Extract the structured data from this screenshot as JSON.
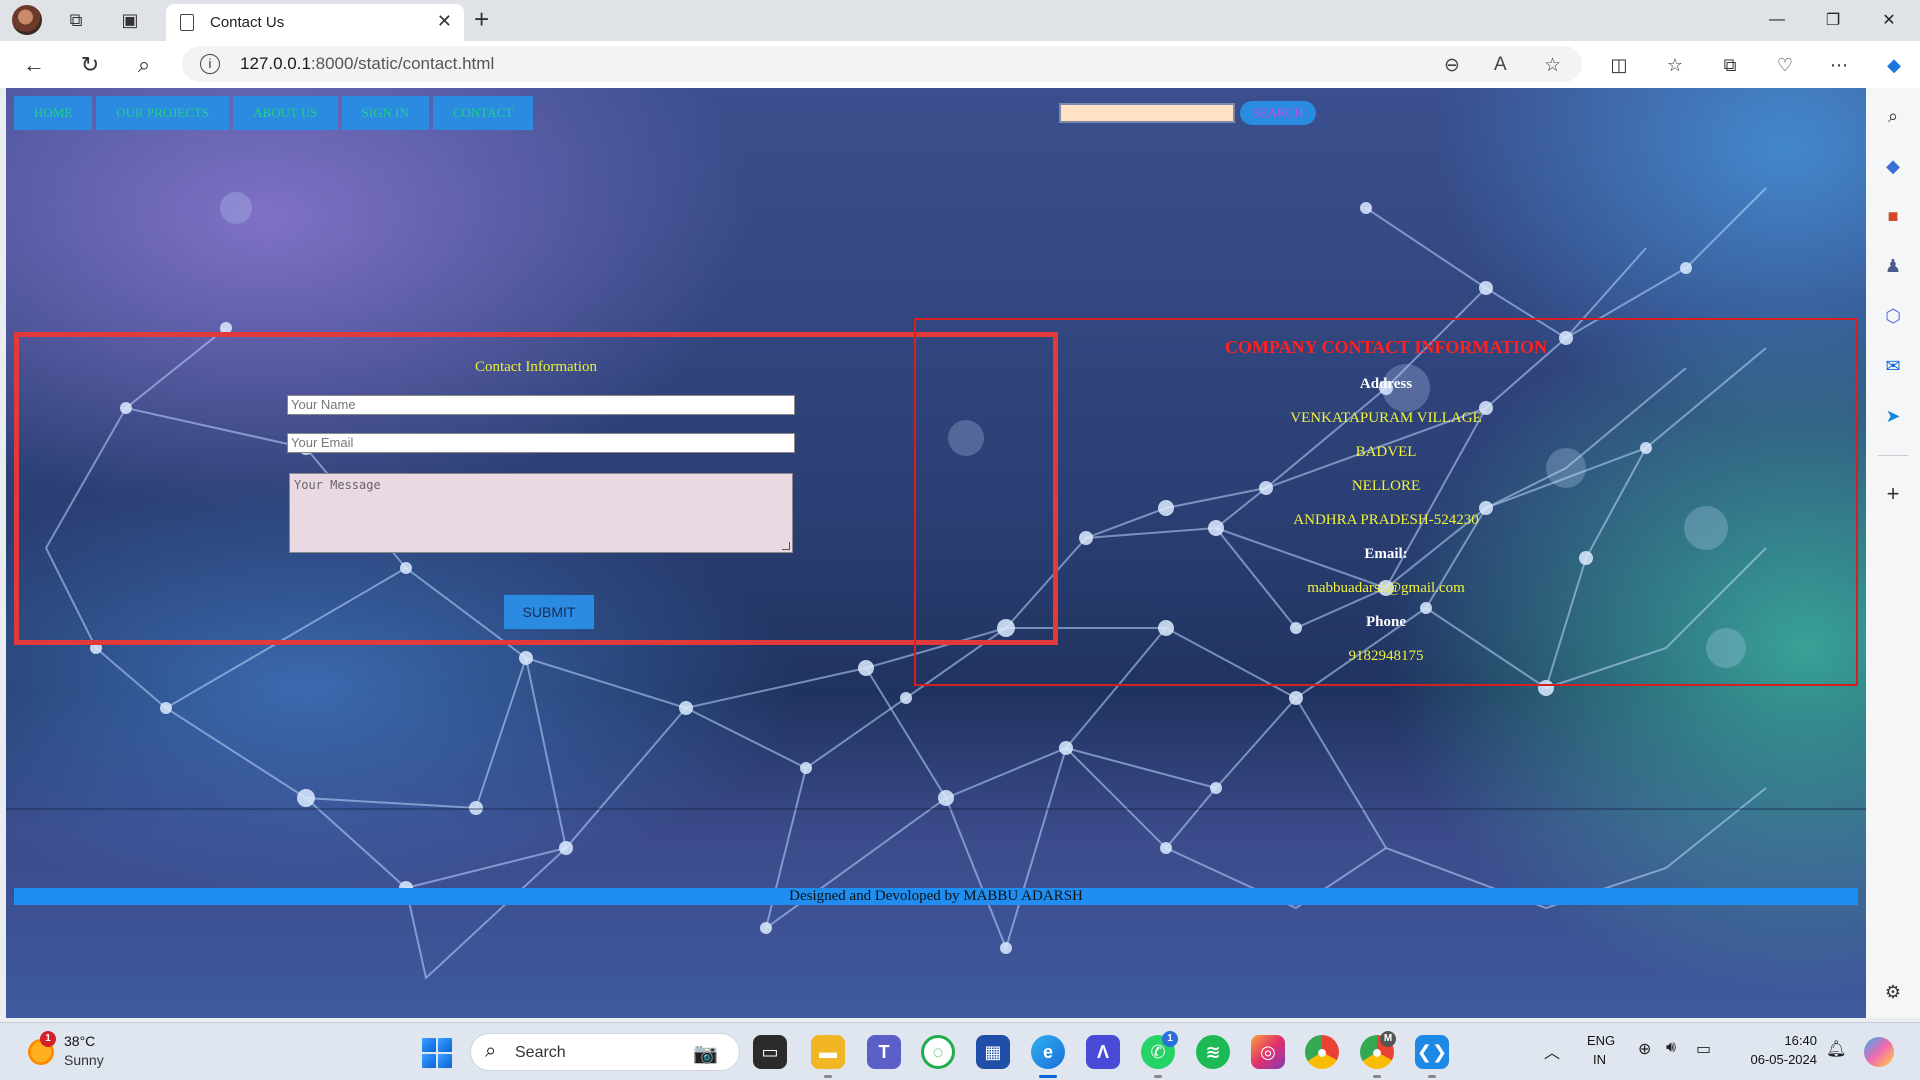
{
  "browser": {
    "tab_title": "Contact Us",
    "url_host": "127.0.0.1",
    "url_rest": ":8000/static/contact.html"
  },
  "site": {
    "nav": [
      "HOME",
      "OUR PROJECTS",
      "ABOUT US",
      "SIGN IN",
      "CONTACT"
    ],
    "search_button": "SEARCH",
    "form": {
      "title": "Contact Information",
      "name_placeholder": "Your Name",
      "email_placeholder": "Your Email",
      "message_placeholder": "Your Message",
      "submit": "SUBMIT"
    },
    "company": {
      "title": "COMPANY CONTACT INFORMATION",
      "address_label": "Address",
      "address_lines": [
        "VENKATAPURAM VILLAGE",
        "BADVEL",
        "NELLORE",
        "ANDHRA PRADESH-524230"
      ],
      "email_label": "Email:",
      "email": "mabbuadarsh@gmail.com",
      "phone_label": "Phone",
      "phone": "9182948175"
    },
    "footer": "Designed and Devoloped by MABBU ADARSH"
  },
  "taskbar": {
    "weather_badge": "1",
    "temperature": "38°C",
    "weather": "Sunny",
    "search_label": "Search",
    "whatsapp_badge": "1",
    "chrome_badge": "M",
    "lang_top": "ENG",
    "lang_bottom": "IN",
    "time": "16:40",
    "date": "06-05-2024"
  },
  "colors": {
    "nav_bg": "#2a8be0",
    "nav_text": "#23d08a",
    "panel_border": "#e23a3a",
    "info_title": "#ff2020",
    "info_value": "#f2f23a",
    "footer_bg": "#1f8ef0"
  }
}
